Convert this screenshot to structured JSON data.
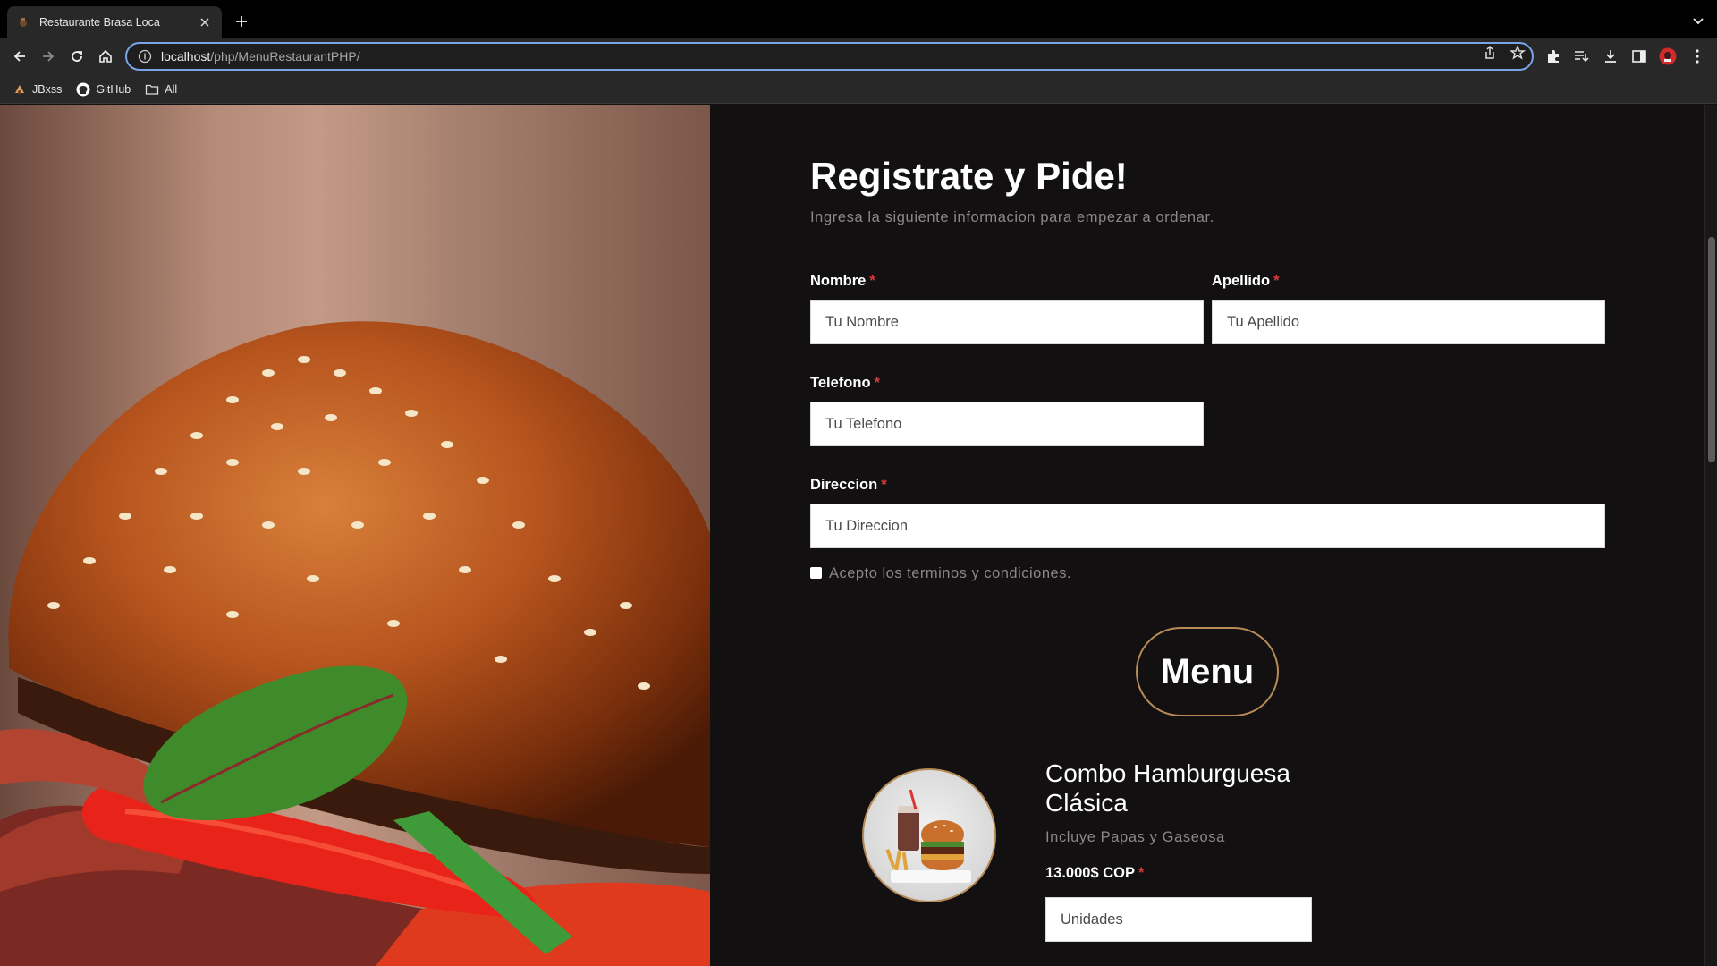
{
  "browser": {
    "tab_title": "Restaurante Brasa Loca",
    "url_host": "localhost",
    "url_path": "/php/MenuRestaurantPHP/",
    "bookmarks": [
      {
        "label": "JBxss",
        "icon": "jbxss-favicon-icon"
      },
      {
        "label": "GitHub",
        "icon": "github-icon"
      },
      {
        "label": "All",
        "icon": "folder-icon"
      }
    ]
  },
  "form": {
    "heading": "Registrate y Pide!",
    "subtitle": "Ingresa la siguiente informacion para empezar a ordenar.",
    "required_mark": "*",
    "fields": {
      "nombre": {
        "label": "Nombre",
        "placeholder": "Tu Nombre"
      },
      "apellido": {
        "label": "Apellido",
        "placeholder": "Tu Apellido"
      },
      "telefono": {
        "label": "Telefono",
        "placeholder": "Tu Telefono"
      },
      "direccion": {
        "label": "Direccion",
        "placeholder": "Tu Direccion"
      }
    },
    "terms_label": "Acepto los terminos y condiciones.",
    "terms_checked": false
  },
  "menu": {
    "title": "Menu",
    "items": [
      {
        "name": "Combo Hamburguesa Clásica",
        "description": "Incluye Papas y Gaseosa",
        "price": "13.000$ COP",
        "quantity_placeholder": "Unidades"
      }
    ]
  },
  "colors": {
    "background": "#131011",
    "accent_gold": "#b68b56",
    "required_red": "#d73a3a",
    "muted_text": "#8a8789",
    "focus_ring": "#7aa4e8"
  }
}
